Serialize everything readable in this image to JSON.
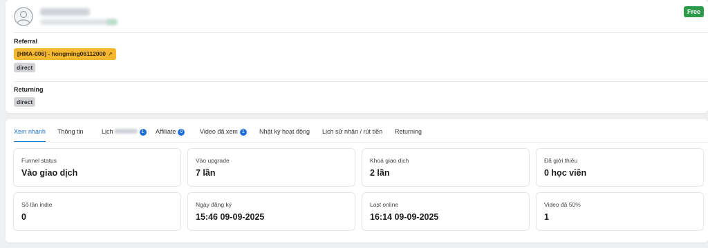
{
  "header": {
    "plan_badge": "Free"
  },
  "referral": {
    "label": "Referral",
    "link": "[HMA-006] - hongming06112000",
    "link_icon": "external-link-icon",
    "source": "direct"
  },
  "returning": {
    "label": "Returning",
    "source": "direct"
  },
  "tabs": [
    {
      "label": "Xem nhanh",
      "active": true
    },
    {
      "label": "Thông tin"
    },
    {
      "label": "Lịch",
      "count": "1",
      "blurred": true
    },
    {
      "label": "Affiliate",
      "count": "0"
    },
    {
      "label": "Video đã xem",
      "count": "1"
    },
    {
      "label": "Nhật ký hoạt động"
    },
    {
      "label": "Lịch sử nhận / rút tiền"
    },
    {
      "label": "Returning"
    }
  ],
  "stats": [
    {
      "label": "Funnel status",
      "value": "Vào giao dịch"
    },
    {
      "label": "Vào upgrade",
      "value": "7 lần"
    },
    {
      "label": "Khoá giao dịch",
      "value": "2 lần"
    },
    {
      "label": "Đã giới thiệu",
      "value": "0 học viên"
    },
    {
      "label": "Số lần indie",
      "value": "0"
    },
    {
      "label": "Ngày đăng ký",
      "value": "15:46 09-09-2025"
    },
    {
      "label": "Last online",
      "value": "16:14 09-09-2025"
    },
    {
      "label": "Video đã 50%",
      "value": "1"
    }
  ],
  "colors": {
    "accent": "#1a73c8",
    "free_badge": "#2e9b4b",
    "referral_chip": "#f5b731",
    "source_chip": "#d2d4d7"
  }
}
